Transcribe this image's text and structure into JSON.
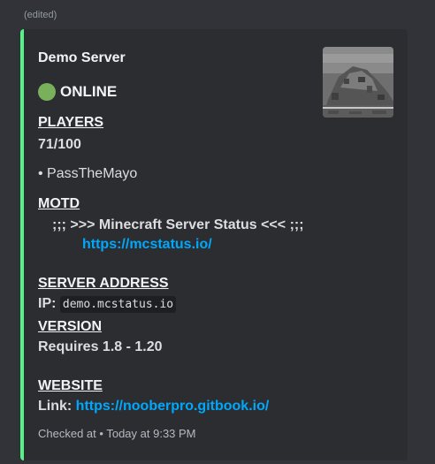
{
  "message": {
    "edited_label": "(edited)"
  },
  "embed": {
    "accent_color": "#57f287",
    "title": "Demo Server",
    "status": {
      "icon": "green-circle",
      "text": "ONLINE"
    },
    "players": {
      "heading": "PLAYERS",
      "count": "71/100",
      "list_item": "• PassTheMayo"
    },
    "motd": {
      "heading": "MOTD",
      "line1": ";;; >>> Minecraft Server Status <<< ;;;",
      "link": "https://mcstatus.io/"
    },
    "server_address": {
      "heading": "SERVER ADDRESS",
      "label": "IP:",
      "value": "demo.mcstatus.io"
    },
    "version": {
      "heading": "VERSION",
      "value": "Requires 1.8 - 1.20"
    },
    "website": {
      "heading": "WEBSITE",
      "label": "Link:",
      "link": "https://nooberpro.gitbook.io/"
    },
    "footer": {
      "label": "Checked at",
      "separator": "•",
      "time": "Today at 9:33 PM"
    }
  }
}
